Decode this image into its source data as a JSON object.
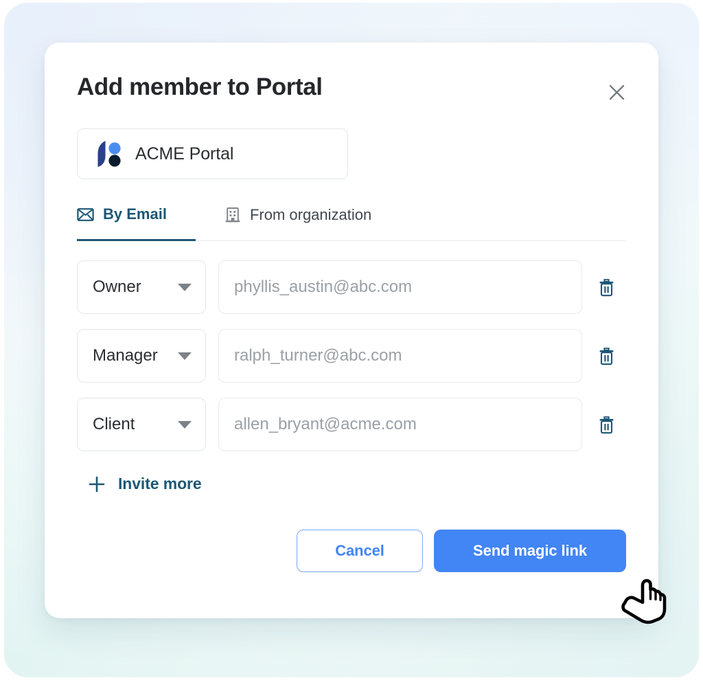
{
  "modal": {
    "title": "Add member to Portal",
    "close_icon": "close-icon"
  },
  "portal": {
    "name": "ACME Portal",
    "logo_icon": "acme-portal-logo-icon",
    "logo_colors": {
      "leaf": "#2b3f8c",
      "circle_top": "#4a8df0",
      "circle_bottom": "#081c2e"
    }
  },
  "tabs": [
    {
      "label": "By Email",
      "icon": "envelope-icon",
      "active": true
    },
    {
      "label": "From organization",
      "icon": "building-icon",
      "active": false
    }
  ],
  "rows": [
    {
      "role": "Owner",
      "email_placeholder": "phyllis_austin@abc.com",
      "email_value": "",
      "delete_icon": "trash-icon"
    },
    {
      "role": "Manager",
      "email_placeholder": "ralph_turner@abc.com",
      "email_value": "",
      "delete_icon": "trash-icon"
    },
    {
      "role": "Client",
      "email_placeholder": "allen_bryant@acme.com",
      "email_value": "",
      "delete_icon": "trash-icon"
    }
  ],
  "role_options": [
    "Owner",
    "Manager",
    "Client"
  ],
  "invite_more": {
    "label": "Invite more",
    "icon": "plus-icon"
  },
  "footer": {
    "cancel_label": "Cancel",
    "primary_label": "Send magic link"
  },
  "colors": {
    "accent_blue": "#4285f4",
    "teal_blue": "#1d5775",
    "placeholder_gray": "#9aa0a6",
    "title_dark": "#25272b"
  },
  "cursor": {
    "icon": "pointing-hand-cursor"
  }
}
